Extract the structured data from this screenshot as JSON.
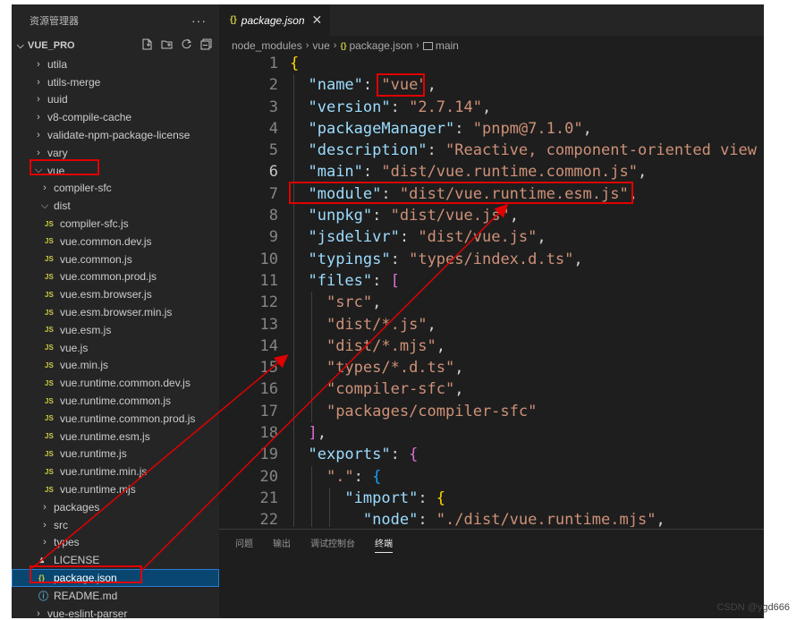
{
  "explorer": {
    "title": "资源管理器",
    "more": "···",
    "project": "VUE_PRO",
    "items": [
      {
        "label": "utila",
        "type": "folder",
        "open": false
      },
      {
        "label": "utils-merge",
        "type": "folder",
        "open": false
      },
      {
        "label": "uuid",
        "type": "folder",
        "open": false
      },
      {
        "label": "v8-compile-cache",
        "type": "folder",
        "open": false
      },
      {
        "label": "validate-npm-package-license",
        "type": "folder",
        "open": false
      },
      {
        "label": "vary",
        "type": "folder",
        "open": false
      },
      {
        "label": "vue",
        "type": "folder",
        "open": true
      },
      {
        "label": "compiler-sfc",
        "type": "folder",
        "open": false
      },
      {
        "label": "dist",
        "type": "folder",
        "open": true
      },
      {
        "label": "compiler-sfc.js",
        "type": "js"
      },
      {
        "label": "vue.common.dev.js",
        "type": "js"
      },
      {
        "label": "vue.common.js",
        "type": "js"
      },
      {
        "label": "vue.common.prod.js",
        "type": "js"
      },
      {
        "label": "vue.esm.browser.js",
        "type": "js"
      },
      {
        "label": "vue.esm.browser.min.js",
        "type": "js"
      },
      {
        "label": "vue.esm.js",
        "type": "js"
      },
      {
        "label": "vue.js",
        "type": "js"
      },
      {
        "label": "vue.min.js",
        "type": "js"
      },
      {
        "label": "vue.runtime.common.dev.js",
        "type": "js"
      },
      {
        "label": "vue.runtime.common.js",
        "type": "js"
      },
      {
        "label": "vue.runtime.common.prod.js",
        "type": "js"
      },
      {
        "label": "vue.runtime.esm.js",
        "type": "js"
      },
      {
        "label": "vue.runtime.js",
        "type": "js"
      },
      {
        "label": "vue.runtime.min.js",
        "type": "js"
      },
      {
        "label": "vue.runtime.mjs",
        "type": "js"
      },
      {
        "label": "packages",
        "type": "folder",
        "open": false
      },
      {
        "label": "src",
        "type": "folder",
        "open": false
      },
      {
        "label": "types",
        "type": "folder",
        "open": false
      },
      {
        "label": "LICENSE",
        "type": "license"
      },
      {
        "label": "package.json",
        "type": "json",
        "selected": true
      },
      {
        "label": "README.md",
        "type": "info"
      },
      {
        "label": "vue-eslint-parser",
        "type": "folder",
        "open": false
      }
    ]
  },
  "icons": {
    "js": "JS",
    "json": "{}",
    "license": "license-icon",
    "info": "info-icon",
    "folder_closed": "chevron-right-icon",
    "folder_open": "chevron-down-icon"
  },
  "editor": {
    "tab": {
      "icon": "{}",
      "label": "package.json",
      "close": "✕"
    },
    "breadcrumb": [
      "node_modules",
      "vue",
      "package.json",
      "main"
    ],
    "active_line": 6,
    "lines": [
      {
        "n": "1",
        "tokens": [
          {
            "t": "{",
            "c": "b1"
          }
        ]
      },
      {
        "n": "2",
        "tokens": [
          {
            "t": "\"name\"",
            "c": "k"
          },
          {
            "t": ": ",
            "c": "p"
          },
          {
            "t": "\"vue\"",
            "c": "s"
          },
          {
            "t": ",",
            "c": "p"
          }
        ]
      },
      {
        "n": "3",
        "tokens": [
          {
            "t": "\"version\"",
            "c": "k"
          },
          {
            "t": ": ",
            "c": "p"
          },
          {
            "t": "\"2.7.14\"",
            "c": "s"
          },
          {
            "t": ",",
            "c": "p"
          }
        ]
      },
      {
        "n": "4",
        "tokens": [
          {
            "t": "\"packageManager\"",
            "c": "k"
          },
          {
            "t": ": ",
            "c": "p"
          },
          {
            "t": "\"pnpm@7.1.0\"",
            "c": "s"
          },
          {
            "t": ",",
            "c": "p"
          }
        ]
      },
      {
        "n": "5",
        "tokens": [
          {
            "t": "\"description\"",
            "c": "k"
          },
          {
            "t": ": ",
            "c": "p"
          },
          {
            "t": "\"Reactive, component-oriented view la",
            "c": "s"
          }
        ]
      },
      {
        "n": "6",
        "tokens": [
          {
            "t": "\"main\"",
            "c": "k"
          },
          {
            "t": ": ",
            "c": "p"
          },
          {
            "t": "\"dist/vue.runtime.common.js\"",
            "c": "s"
          },
          {
            "t": ",",
            "c": "p"
          }
        ]
      },
      {
        "n": "7",
        "tokens": [
          {
            "t": "\"module\"",
            "c": "k"
          },
          {
            "t": ": ",
            "c": "p"
          },
          {
            "t": "\"dist/vue.runtime.esm.js\"",
            "c": "s"
          },
          {
            "t": ",",
            "c": "p"
          }
        ]
      },
      {
        "n": "8",
        "tokens": [
          {
            "t": "\"unpkg\"",
            "c": "k"
          },
          {
            "t": ": ",
            "c": "p"
          },
          {
            "t": "\"dist/vue.js\"",
            "c": "s"
          },
          {
            "t": ",",
            "c": "p"
          }
        ]
      },
      {
        "n": "9",
        "tokens": [
          {
            "t": "\"jsdelivr\"",
            "c": "k"
          },
          {
            "t": ": ",
            "c": "p"
          },
          {
            "t": "\"dist/vue.js\"",
            "c": "s"
          },
          {
            "t": ",",
            "c": "p"
          }
        ]
      },
      {
        "n": "10",
        "tokens": [
          {
            "t": "\"typings\"",
            "c": "k"
          },
          {
            "t": ": ",
            "c": "p"
          },
          {
            "t": "\"types/index.d.ts\"",
            "c": "s"
          },
          {
            "t": ",",
            "c": "p"
          }
        ]
      },
      {
        "n": "11",
        "tokens": [
          {
            "t": "\"files\"",
            "c": "k"
          },
          {
            "t": ": ",
            "c": "p"
          },
          {
            "t": "[",
            "c": "b2"
          }
        ]
      },
      {
        "n": "12",
        "tokens": [
          {
            "t": "  \"src\"",
            "c": "s"
          },
          {
            "t": ",",
            "c": "p"
          }
        ]
      },
      {
        "n": "13",
        "tokens": [
          {
            "t": "  \"dist/*.js\"",
            "c": "s"
          },
          {
            "t": ",",
            "c": "p"
          }
        ]
      },
      {
        "n": "14",
        "tokens": [
          {
            "t": "  \"dist/*.mjs\"",
            "c": "s"
          },
          {
            "t": ",",
            "c": "p"
          }
        ]
      },
      {
        "n": "15",
        "tokens": [
          {
            "t": "  \"types/*.d.ts\"",
            "c": "s"
          },
          {
            "t": ",",
            "c": "p"
          }
        ]
      },
      {
        "n": "16",
        "tokens": [
          {
            "t": "  \"compiler-sfc\"",
            "c": "s"
          },
          {
            "t": ",",
            "c": "p"
          }
        ]
      },
      {
        "n": "17",
        "tokens": [
          {
            "t": "  \"packages/compiler-sfc\"",
            "c": "s"
          }
        ]
      },
      {
        "n": "18",
        "tokens": [
          {
            "t": "]",
            "c": "b2"
          },
          {
            "t": ",",
            "c": "p"
          }
        ]
      },
      {
        "n": "19",
        "tokens": [
          {
            "t": "\"exports\"",
            "c": "k"
          },
          {
            "t": ": ",
            "c": "p"
          },
          {
            "t": "{",
            "c": "b2"
          }
        ]
      },
      {
        "n": "20",
        "tokens": [
          {
            "t": "  \".\"",
            "c": "s"
          },
          {
            "t": ": ",
            "c": "p"
          },
          {
            "t": "{",
            "c": "b3"
          }
        ]
      },
      {
        "n": "21",
        "tokens": [
          {
            "t": "    \"import\"",
            "c": "k"
          },
          {
            "t": ": ",
            "c": "p"
          },
          {
            "t": "{",
            "c": "b1"
          }
        ]
      },
      {
        "n": "22",
        "tokens": [
          {
            "t": "      \"node\"",
            "c": "k"
          },
          {
            "t": ": ",
            "c": "p"
          },
          {
            "t": "\"./dist/vue.runtime.mjs\"",
            "c": "s"
          },
          {
            "t": ",",
            "c": "p"
          }
        ]
      }
    ]
  },
  "panel": {
    "tabs": [
      "问题",
      "输出",
      "调试控制台",
      "终端"
    ],
    "active": 3
  },
  "watermark": "CSDN @ygd666",
  "colors": {
    "annotation": "#e00000",
    "selection": "#094771",
    "string": "#ce9178",
    "key": "#9cdcfe"
  }
}
